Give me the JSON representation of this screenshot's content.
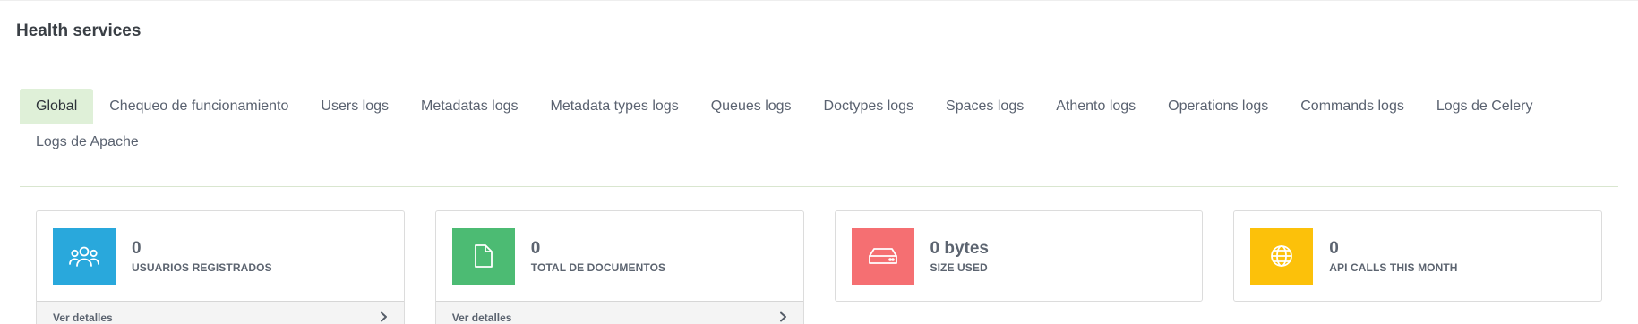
{
  "header": {
    "title": "Health services"
  },
  "tabs": [
    {
      "label": "Global",
      "active": true
    },
    {
      "label": "Chequeo de funcionamiento"
    },
    {
      "label": "Users logs"
    },
    {
      "label": "Metadatas logs"
    },
    {
      "label": "Metadata types logs"
    },
    {
      "label": "Queues logs"
    },
    {
      "label": "Doctypes logs"
    },
    {
      "label": "Spaces logs"
    },
    {
      "label": "Athento logs"
    },
    {
      "label": "Operations logs"
    },
    {
      "label": "Commands logs"
    },
    {
      "label": "Logs de Celery"
    },
    {
      "label": "Logs de Apache"
    }
  ],
  "cards": [
    {
      "value": "0",
      "label": "USUARIOS REGISTRADOS",
      "icon": "users-icon",
      "color": "#29a8dc",
      "footer": "Ver detalles"
    },
    {
      "value": "0",
      "label": "TOTAL DE DOCUMENTOS",
      "icon": "document-icon",
      "color": "#4cbb73",
      "footer": "Ver detalles"
    },
    {
      "value": "0 bytes",
      "label": "SIZE USED",
      "icon": "hard-drive-icon",
      "color": "#f56f72"
    },
    {
      "value": "0",
      "label": "API CALLS THIS MONTH",
      "icon": "globe-icon",
      "color": "#fcc10a"
    }
  ],
  "colors": {
    "active_tab_bg": "#dff0d8"
  }
}
